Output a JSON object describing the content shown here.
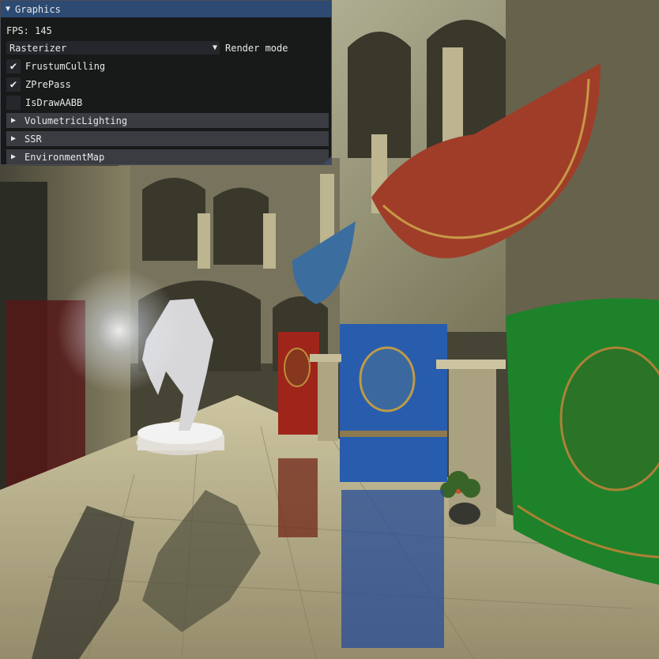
{
  "panel": {
    "title": "Graphics",
    "fps_text": "FPS: 145",
    "render_mode": {
      "selected": "Rasterizer",
      "caption": "Render mode"
    },
    "checkboxes": [
      {
        "label": "FrustumCulling",
        "checked": true
      },
      {
        "label": "ZPrePass",
        "checked": true
      },
      {
        "label": "IsDrawAABB",
        "checked": false
      }
    ],
    "headers": [
      {
        "label": "VolumetricLighting"
      },
      {
        "label": "SSR"
      },
      {
        "label": "EnvironmentMap"
      }
    ]
  },
  "icons": {
    "collapse_arrow": "triangle-down-icon",
    "expand_arrow": "triangle-right-icon",
    "check_mark": "checkmark-icon",
    "combo_arrow": "triangle-down-icon"
  },
  "colors": {
    "title_bar": "#2c4a72",
    "window_bg": "#141518",
    "frame_bg": "#26272c",
    "header_bg": "#3b3c42",
    "text": "#e8e8e8"
  }
}
